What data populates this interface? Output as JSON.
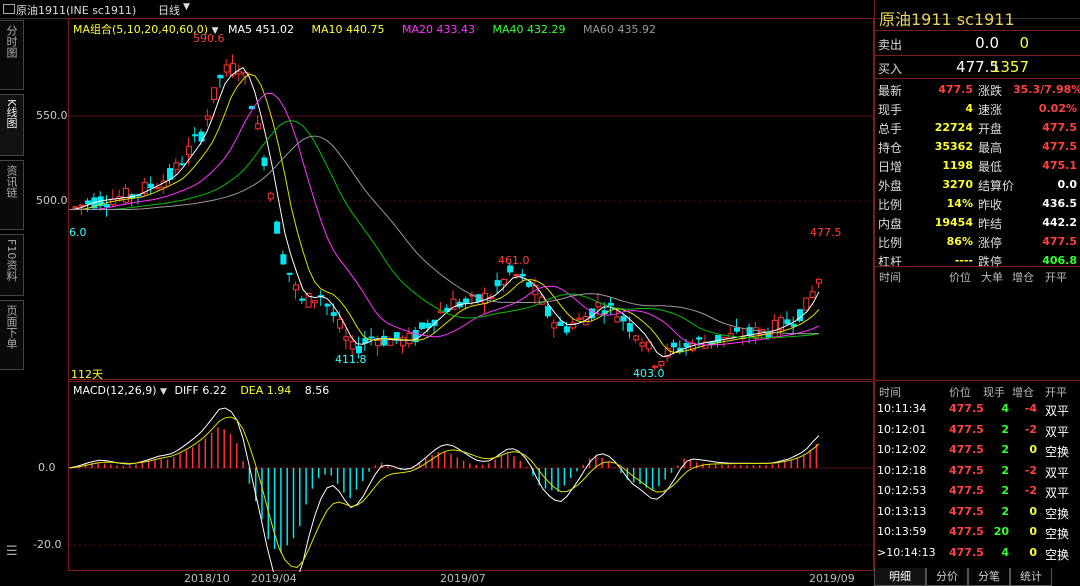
{
  "titlebar": {
    "title": "原油1911(INE sc1911)",
    "period": "日线"
  },
  "left_tabs": [
    {
      "label": "分时图"
    },
    {
      "label": "K线图"
    },
    {
      "label": "资讯链"
    },
    {
      "label": "F10资料"
    },
    {
      "label": "页面下单"
    }
  ],
  "menu_icon": "menu-icon",
  "ma_legend": {
    "label": "MA组合(5,10,20,40,60,0)",
    "ma5": "MA5 451.02",
    "ma10": "MA10 440.75",
    "ma20": "MA20 433.43",
    "ma40": "MA40 432.29",
    "ma60": "MA60 435.92"
  },
  "price_axis": [
    "550.0",
    "500.0"
  ],
  "annotations": {
    "high": "590.6",
    "low1": "411.8",
    "peak2": "461.0",
    "low2": "403.0",
    "last": "477.5",
    "start": "6.0",
    "days": "112天"
  },
  "macd_legend": {
    "label": "MACD(12,26,9)",
    "diff": "DIFF 6.22",
    "dea": "DEA 1.94",
    "macd": "8.56"
  },
  "macd_axis": [
    "0.0",
    "-20.0"
  ],
  "date_axis": [
    "2018/10",
    "2019/04",
    "2019/07",
    "2019/09"
  ],
  "colors": {
    "up": "#ff3333",
    "down": "#00e5ee",
    "ma5": "#ffffff",
    "ma10": "#e0e000",
    "ma20": "#ff33ff",
    "ma40": "#00c000",
    "ma60": "#999999",
    "frame": "#7a1c1c"
  },
  "quote": {
    "title": "原油1911  sc1911",
    "sell_label": "卖出",
    "sell_price": "0.0",
    "sell_vol": "0",
    "buy_label": "买入",
    "buy_price": "477.5",
    "buy_vol": "1357",
    "rows": [
      {
        "l1": "最新",
        "v1": "477.5",
        "l2": "涨跌",
        "v2": "35.3/7.98%"
      },
      {
        "l1": "现手",
        "v1": "4",
        "l2": "速涨",
        "v2": "0.02%"
      },
      {
        "l1": "总手",
        "v1": "22724",
        "l2": "开盘",
        "v2": "477.5"
      },
      {
        "l1": "持仓",
        "v1": "35362",
        "l2": "最高",
        "v2": "477.5"
      },
      {
        "l1": "日增",
        "v1": "1198",
        "l2": "最低",
        "v2": "475.1"
      },
      {
        "l1": "外盘",
        "v1": "3270",
        "l2": "结算价",
        "v2": "0.0"
      },
      {
        "l1": "比例",
        "v1": "14%",
        "l2": "昨收",
        "v2": "436.5"
      },
      {
        "l1": "内盘",
        "v1": "19454",
        "l2": "昨结",
        "v2": "442.2"
      },
      {
        "l1": "比例",
        "v1": "86%",
        "l2": "涨停",
        "v2": "477.5"
      },
      {
        "l1": "杠杆",
        "v1": "----",
        "l2": "跌停",
        "v2": "406.8"
      }
    ],
    "tick_headers": [
      "时间",
      "价位",
      "大单",
      "增仓",
      "开平"
    ],
    "trade_headers": [
      "时间",
      "价位",
      "现手",
      "增仓",
      "开平"
    ],
    "trades": [
      {
        "time": "10:11:34",
        "price": "477.5",
        "vol": "4",
        "chg": "-4",
        "type": "双平"
      },
      {
        "time": "10:12:01",
        "price": "477.5",
        "vol": "2",
        "chg": "-2",
        "type": "双平"
      },
      {
        "time": "10:12:02",
        "price": "477.5",
        "vol": "2",
        "chg": "0",
        "type": "空换"
      },
      {
        "time": "10:12:18",
        "price": "477.5",
        "vol": "2",
        "chg": "-2",
        "type": "双平"
      },
      {
        "time": "10:12:53",
        "price": "477.5",
        "vol": "2",
        "chg": "-2",
        "type": "双平"
      },
      {
        "time": "10:13:13",
        "price": "477.5",
        "vol": "2",
        "chg": "0",
        "type": "空换"
      },
      {
        "time": "10:13:59",
        "price": "477.5",
        "vol": "20",
        "chg": "0",
        "type": "空换"
      },
      {
        "time": ">10:14:13",
        "price": "477.5",
        "vol": "4",
        "chg": "0",
        "type": "空换"
      }
    ],
    "bottom_tabs": [
      "明细",
      "分价",
      "分笔",
      "统计"
    ]
  }
}
